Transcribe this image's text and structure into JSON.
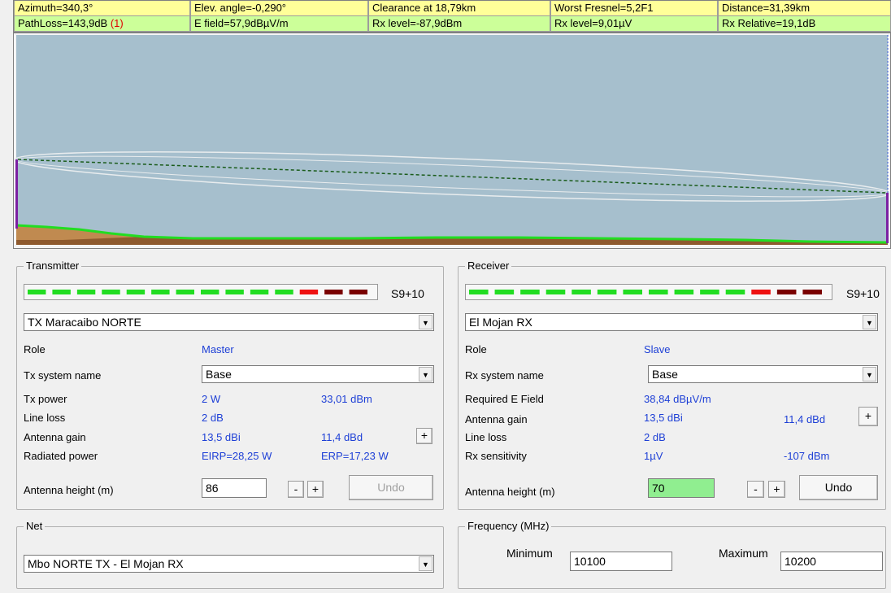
{
  "info": {
    "azimuth": "Azimuth=340,3°",
    "elev": "Elev. angle=-0,290°",
    "clearance": "Clearance at 18,79km",
    "fresnel": "Worst Fresnel=5,2F1",
    "distance": "Distance=31,39km",
    "pathloss": "PathLoss=143,9dB ",
    "pathloss_flag": "(1)",
    "efield": "E field=57,9dBµV/m",
    "rxlevel_dbm": "Rx level=-87,9dBm",
    "rxlevel_uv": "Rx level=9,01µV",
    "rxrel": "Rx Relative=19,1dB"
  },
  "colors": {
    "info_yellow": "#ffff99",
    "info_green": "#ccff99",
    "sky": "#a6bfcd",
    "terrain": "#8e5a2e",
    "terrain_top": "#22dd22",
    "fresnel": "#e8ecee",
    "path_line": "#1a5c1a",
    "value_blue": "#1d3fd6",
    "meter_green": "#22dd22",
    "meter_red": "#ee1111",
    "meter_dark": "#7a0000",
    "mast": "#7b1fa2",
    "input_green": "#90ee90"
  },
  "transmitter": {
    "title": "Transmitter",
    "meter_label": "S9+10",
    "station": "TX Maracaibo NORTE",
    "role_label": "Role",
    "role": "Master",
    "system_label": "Tx system name",
    "system": "Base",
    "power_label": "Tx power",
    "power_w": "2 W",
    "power_dbm": "33,01 dBm",
    "lineloss_label": "Line loss",
    "lineloss": "2 dB",
    "gain_label": "Antenna gain",
    "gain_dbi": "13,5 dBi",
    "gain_dbd": "11,4 dBd",
    "radiated_label": "Radiated power",
    "eirp": "EIRP=28,25 W",
    "erp": "ERP=17,23 W",
    "height_label": "Antenna height (m)",
    "height": "86",
    "minus": "-",
    "plus": "+",
    "undo": "Undo"
  },
  "receiver": {
    "title": "Receiver",
    "meter_label": "S9+10",
    "station": "El Mojan RX",
    "role_label": "Role",
    "role": "Slave",
    "system_label": "Rx system name",
    "system": "Base",
    "efield_label": "Required E Field",
    "efield": "38,84 dBµV/m",
    "gain_label": "Antenna gain",
    "gain_dbi": "13,5 dBi",
    "gain_dbd": "11,4 dBd",
    "lineloss_label": "Line loss",
    "lineloss": "2 dB",
    "sens_label": "Rx sensitivity",
    "sens_uv": "1µV",
    "sens_dbm": "-107 dBm",
    "height_label": "Antenna height (m)",
    "height": "70",
    "minus": "-",
    "plus": "+",
    "undo": "Undo"
  },
  "net": {
    "title": "Net",
    "value": "Mbo NORTE TX - El Mojan RX"
  },
  "frequency": {
    "title": "Frequency (MHz)",
    "min_label": "Minimum",
    "min": "10100",
    "max_label": "Maximum",
    "max": "10200"
  }
}
